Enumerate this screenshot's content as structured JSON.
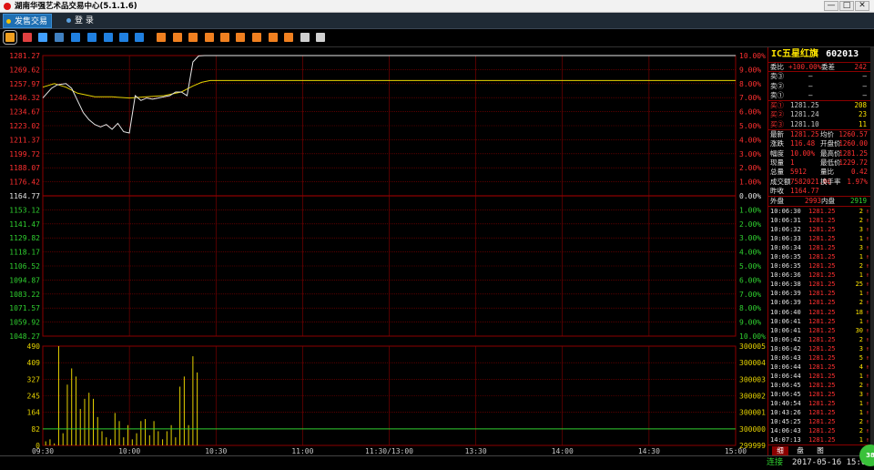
{
  "window": {
    "title": "湖南华强艺术品交易中心(5.1.1.6)",
    "minimize": "—",
    "maximize": "□",
    "close": "✕"
  },
  "menu": {
    "tabs": [
      {
        "label": "发售交易",
        "active": true
      },
      {
        "label": "登  录",
        "active": false
      }
    ]
  },
  "toolbar": {
    "icons": [
      {
        "name": "timeshare-icon",
        "color": "#f0a020",
        "selected": true
      },
      {
        "name": "kline-icon",
        "color": "#e04040"
      },
      {
        "name": "bars-icon",
        "color": "#40a0ff"
      },
      {
        "name": "calendar-icon",
        "color": "#4080c0"
      },
      {
        "name": "list-icon",
        "color": "#2080e0"
      },
      {
        "name": "grid-icon",
        "color": "#2080e0"
      },
      {
        "name": "refresh-icon",
        "color": "#2080e0"
      },
      {
        "name": "report-icon",
        "color": "#2080e0"
      },
      {
        "name": "export-icon",
        "color": "#2080e0"
      },
      {
        "name": "order-icon-1",
        "color": "#f08020"
      },
      {
        "name": "order-icon-2",
        "color": "#f08020"
      },
      {
        "name": "order-icon-3",
        "color": "#f08020"
      },
      {
        "name": "order-icon-4",
        "color": "#f08020"
      },
      {
        "name": "order-icon-5",
        "color": "#f08020"
      },
      {
        "name": "order-icon-6",
        "color": "#f08020"
      },
      {
        "name": "order-icon-7",
        "color": "#f08020"
      },
      {
        "name": "order-icon-8",
        "color": "#f08020"
      },
      {
        "name": "order-icon-9",
        "color": "#f08020"
      },
      {
        "name": "edit-icon",
        "color": "#d0d0d0"
      },
      {
        "name": "settings-icon",
        "color": "#d0d0d0"
      }
    ]
  },
  "chart_data": {
    "type": "line",
    "subtype": "intraday-timeshare",
    "prev_close": 1164.77,
    "price_ticks_left": [
      "1281.27",
      "1269.62",
      "1257.97",
      "1246.32",
      "1234.67",
      "1223.02",
      "1211.37",
      "1199.72",
      "1188.07",
      "1176.42",
      "1164.77",
      "1153.12",
      "1141.47",
      "1129.82",
      "1118.17",
      "1106.52",
      "1094.87",
      "1083.22",
      "1071.57",
      "1059.92",
      "1048.27"
    ],
    "pct_ticks_right": [
      "10.00%",
      "9.00%",
      "8.00%",
      "7.00%",
      "6.00%",
      "5.00%",
      "4.00%",
      "3.00%",
      "2.00%",
      "1.00%",
      "0.00%",
      "1.00%",
      "2.00%",
      "3.00%",
      "4.00%",
      "5.00%",
      "6.00%",
      "7.00%",
      "8.00%",
      "9.00%",
      "10.00%"
    ],
    "ylim": [
      1048.27,
      1281.27
    ],
    "time_labels": [
      "09:30",
      "10:00",
      "10:30",
      "11:00",
      "11:30/13:00",
      "13:30",
      "14:00",
      "14:30",
      "15:00"
    ],
    "price_series": {
      "name": "price",
      "color": "#e6e6e6",
      "points": [
        [
          0,
          1246
        ],
        [
          3,
          1254
        ],
        [
          5,
          1257
        ],
        [
          8,
          1258
        ],
        [
          10,
          1254
        ],
        [
          12,
          1244
        ],
        [
          14,
          1234
        ],
        [
          16,
          1228
        ],
        [
          18,
          1224
        ],
        [
          20,
          1222
        ],
        [
          22,
          1224
        ],
        [
          24,
          1220
        ],
        [
          26,
          1225
        ],
        [
          28,
          1218
        ],
        [
          30,
          1217
        ],
        [
          32,
          1248
        ],
        [
          34,
          1244
        ],
        [
          36,
          1246
        ],
        [
          38,
          1245
        ],
        [
          40,
          1246
        ],
        [
          42,
          1247
        ],
        [
          44,
          1248
        ],
        [
          46,
          1251
        ],
        [
          48,
          1251
        ],
        [
          50,
          1248
        ],
        [
          52,
          1276
        ],
        [
          54,
          1281
        ],
        [
          56,
          1281.25
        ],
        [
          240,
          1281.25
        ]
      ]
    },
    "avg_series": {
      "name": "avg",
      "color": "#e6d200",
      "points": [
        [
          0,
          1255
        ],
        [
          4,
          1258
        ],
        [
          8,
          1255
        ],
        [
          12,
          1250
        ],
        [
          18,
          1247
        ],
        [
          24,
          1247
        ],
        [
          30,
          1246
        ],
        [
          36,
          1247
        ],
        [
          42,
          1248
        ],
        [
          48,
          1251
        ],
        [
          52,
          1256
        ],
        [
          55,
          1259
        ],
        [
          58,
          1260.57
        ],
        [
          240,
          1260.57
        ]
      ]
    },
    "volume_ticks_left": [
      "490",
      "409",
      "327",
      "245",
      "164",
      "82",
      "0"
    ],
    "volume_ticks_right": [
      "300005",
      "300004",
      "300003",
      "300002",
      "300001",
      "300000",
      "299999"
    ],
    "volume_max": 490,
    "volume_bars": [
      20,
      30,
      10,
      490,
      60,
      300,
      380,
      340,
      180,
      230,
      260,
      230,
      140,
      70,
      40,
      30,
      160,
      120,
      40,
      100,
      30,
      60,
      120,
      130,
      50,
      120,
      70,
      30,
      70,
      100,
      40,
      290,
      340,
      100,
      440,
      360
    ],
    "volume_color": "#e6d200",
    "volume_line_color": "#30d030"
  },
  "quote": {
    "name": "IC五星红旗",
    "code": "602013",
    "weibi_label": "委比",
    "weibi_value": "+100.00%",
    "weicha_label": "委差",
    "weicha_value": "242",
    "sells": [
      {
        "label": "卖③",
        "price": "—",
        "vol": "—"
      },
      {
        "label": "卖②",
        "price": "—",
        "vol": "—"
      },
      {
        "label": "卖①",
        "price": "—",
        "vol": "—"
      }
    ],
    "buys": [
      {
        "label": "买①",
        "price": "1281.25",
        "vol": "208"
      },
      {
        "label": "买②",
        "price": "1281.24",
        "vol": "23"
      },
      {
        "label": "买③",
        "price": "1281.10",
        "vol": "11"
      }
    ],
    "stats": [
      {
        "l1": "最新",
        "v1": "1281.25",
        "l2": "均价",
        "v2": "1260.57"
      },
      {
        "l1": "涨跌",
        "v1": "116.48",
        "l2": "开盘价",
        "v2": "1260.00"
      },
      {
        "l1": "幅度",
        "v1": "10.00%",
        "l2": "最高价",
        "v2": "1281.25"
      },
      {
        "l1": "现量",
        "v1": "1",
        "l2": "最低价",
        "v2": "1229.72"
      },
      {
        "l1": "总量",
        "v1": "5912",
        "l2": "量比",
        "v2": "0.42"
      },
      {
        "l1": "成交额",
        "v1": "7582021.00",
        "l2": "换手率",
        "v2": "1.97%"
      },
      {
        "l1": "昨收",
        "v1": "1164.77",
        "l2": "",
        "v2": ""
      }
    ],
    "waipan_label": "外盘",
    "waipan_value": "2993",
    "neipan_label": "内盘",
    "neipan_value": "2919"
  },
  "trades": [
    {
      "time": "10:06:30",
      "price": "1281.25",
      "vol": "2"
    },
    {
      "time": "10:06:31",
      "price": "1281.25",
      "vol": "2"
    },
    {
      "time": "10:06:32",
      "price": "1281.25",
      "vol": "3"
    },
    {
      "time": "10:06:33",
      "price": "1281.25",
      "vol": "1"
    },
    {
      "time": "10:06:34",
      "price": "1281.25",
      "vol": "3"
    },
    {
      "time": "10:06:35",
      "price": "1281.25",
      "vol": "1"
    },
    {
      "time": "10:06:35",
      "price": "1281.25",
      "vol": "2"
    },
    {
      "time": "10:06:36",
      "price": "1281.25",
      "vol": "1"
    },
    {
      "time": "10:06:38",
      "price": "1281.25",
      "vol": "25"
    },
    {
      "time": "10:06:39",
      "price": "1281.25",
      "vol": "1"
    },
    {
      "time": "10:06:39",
      "price": "1281.25",
      "vol": "2"
    },
    {
      "time": "10:06:40",
      "price": "1281.25",
      "vol": "18"
    },
    {
      "time": "10:06:41",
      "price": "1281.25",
      "vol": "1"
    },
    {
      "time": "10:06:41",
      "price": "1281.25",
      "vol": "30"
    },
    {
      "time": "10:06:42",
      "price": "1281.25",
      "vol": "2"
    },
    {
      "time": "10:06:42",
      "price": "1281.25",
      "vol": "3"
    },
    {
      "time": "10:06:43",
      "price": "1281.25",
      "vol": "5"
    },
    {
      "time": "10:06:44",
      "price": "1281.25",
      "vol": "4"
    },
    {
      "time": "10:06:44",
      "price": "1281.25",
      "vol": "1"
    },
    {
      "time": "10:06:45",
      "price": "1281.25",
      "vol": "2"
    },
    {
      "time": "10:06:45",
      "price": "1281.25",
      "vol": "3"
    },
    {
      "time": "10:40:54",
      "price": "1281.25",
      "vol": "1"
    },
    {
      "time": "10:43:26",
      "price": "1281.25",
      "vol": "1"
    },
    {
      "time": "10:45:25",
      "price": "1281.25",
      "vol": "2"
    },
    {
      "time": "14:06:43",
      "price": "1281.25",
      "vol": "2"
    },
    {
      "time": "14:07:13",
      "price": "1281.25",
      "vol": "1"
    }
  ],
  "bottom_tabs": [
    "细",
    "盘",
    "图"
  ],
  "status": {
    "connection": "连接",
    "datetime": "2017-05-16 15:00",
    "badge": "38"
  },
  "colors": {
    "up": "#ff3030",
    "down": "#30d030",
    "grid": "#8b0000",
    "price_line": "#e6e6e6",
    "avg_line": "#e6d200"
  }
}
